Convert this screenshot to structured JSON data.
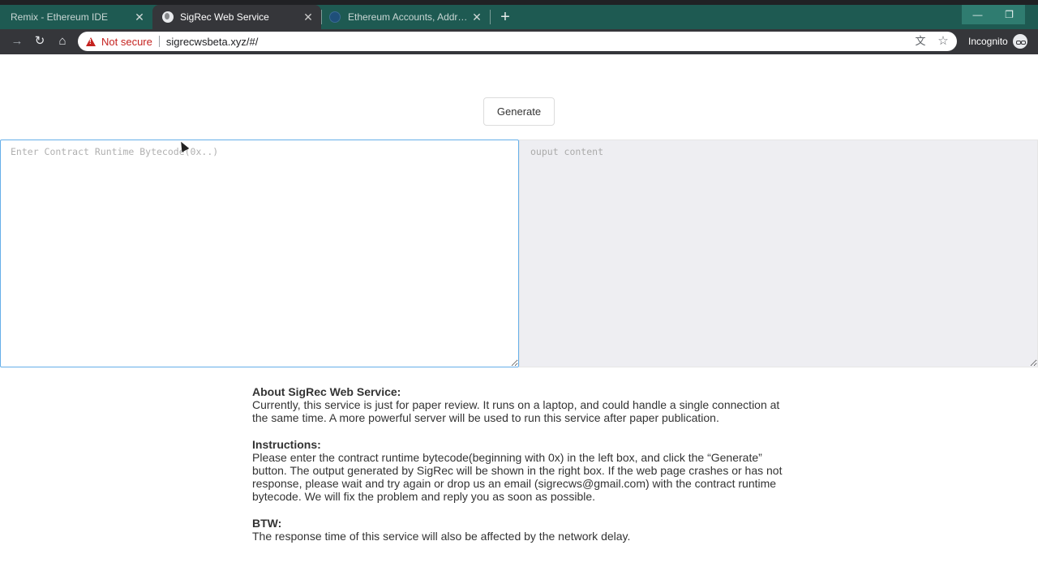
{
  "browser": {
    "tabs": [
      {
        "title": "Remix - Ethereum IDE",
        "active": false,
        "favicon": "remix-icon"
      },
      {
        "title": "SigRec Web Service",
        "active": true,
        "favicon": "globe-icon"
      },
      {
        "title": "Ethereum Accounts, Addresses",
        "active": false,
        "favicon": "ethereum-icon"
      }
    ],
    "close_glyph": "✕",
    "new_tab_glyph": "+",
    "security_label": "Not secure",
    "url": "sigrecwsbeta.xyz/#/",
    "profile_label": "Incognito",
    "colors": {
      "tabstrip": "#1e5a52",
      "toolbar": "#35363a",
      "warning": "#c5221f"
    }
  },
  "page": {
    "generate_label": "Generate",
    "input_placeholder": "Enter Contract Runtime Bytecode(0x..)",
    "output_placeholder": "ouput content",
    "about": {
      "heading": "About SigRec Web Service:",
      "body": "Currently, this service is just for paper review. It runs on a laptop, and could handle a single connection at the same time. A more powerful server will be used to run this service after paper publication."
    },
    "instructions": {
      "heading": "Instructions:",
      "body": "Please enter the contract runtime bytecode(beginning with 0x) in the left box, and click the “Generate” button. The output generated by SigRec will be shown in the right box. If the web page crashes or has not response, please wait and try again or drop us an email (sigrecws@gmail.com) with the contract runtime bytecode. We will fix the problem and reply you as soon as possible."
    },
    "btw": {
      "heading": "BTW:",
      "body": "The response time of this service will also be affected by the network delay."
    }
  }
}
